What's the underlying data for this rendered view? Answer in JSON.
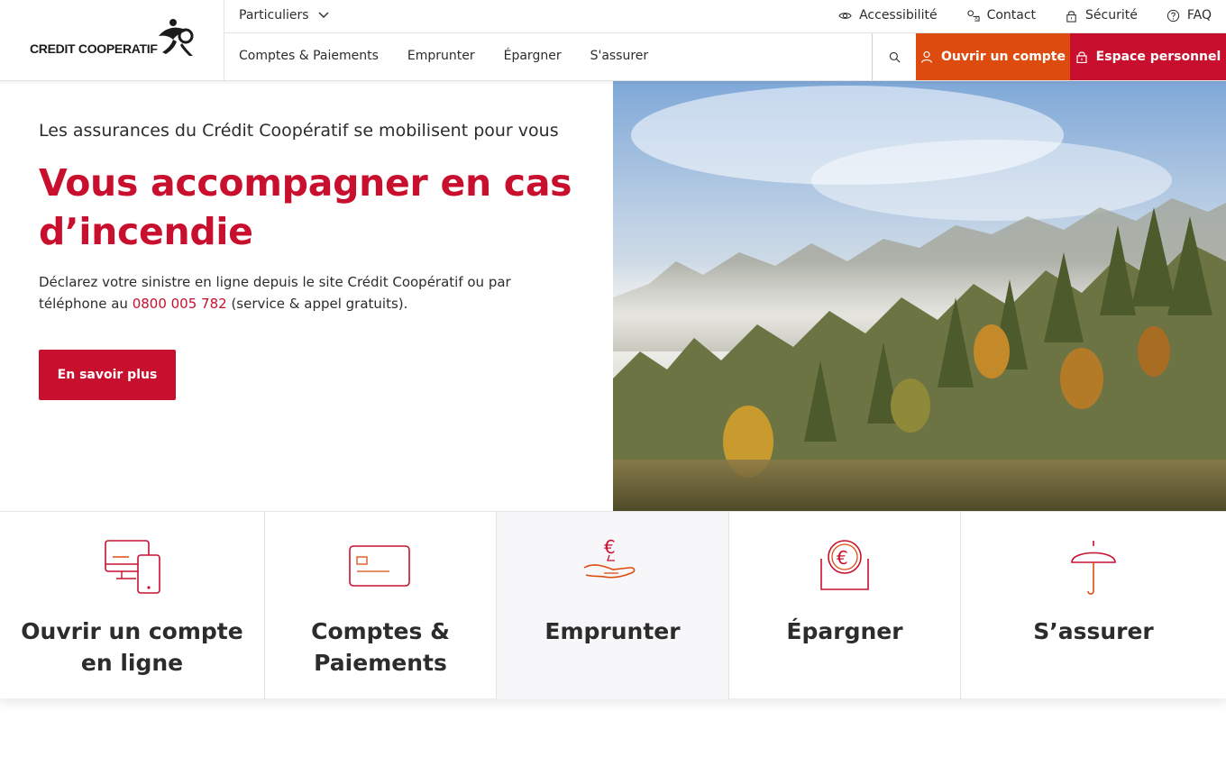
{
  "logo": {
    "text": "CREDIT COOPERATIF"
  },
  "topbar": {
    "segment": "Particuliers",
    "links": [
      {
        "label": "Accessibilité",
        "icon": "eye-icon"
      },
      {
        "label": "Contact",
        "icon": "contact-icon"
      },
      {
        "label": "Sécurité",
        "icon": "lock-icon"
      },
      {
        "label": "FAQ",
        "icon": "help-icon"
      }
    ]
  },
  "nav": {
    "items": [
      "Comptes & Paiements",
      "Emprunter",
      "Épargner",
      "S'assurer"
    ],
    "open_account": "Ouvrir un compte",
    "personal_space": "Espace personnel"
  },
  "hero": {
    "subtitle": "Les assurances du Crédit Coopératif se mobilisent pour vous",
    "title": "Vous accompagner en cas d’incendie",
    "text_before": "Déclarez votre sinistre en ligne depuis le site Crédit Coopératif ou par téléphone au ",
    "phone": "0800 005 782",
    "text_after": " (service & appel gratuits).",
    "cta": "En savoir plus"
  },
  "cards": [
    {
      "label": "Ouvrir un compte en ligne",
      "icon": "devices-icon"
    },
    {
      "label": "Comptes & Paiements",
      "icon": "card-icon"
    },
    {
      "label": "Emprunter",
      "icon": "hand-euro-icon"
    },
    {
      "label": "Épargner",
      "icon": "savings-icon"
    },
    {
      "label": "S’assurer",
      "icon": "umbrella-icon"
    }
  ],
  "colors": {
    "brand_red": "#c8102e",
    "accent_orange": "#dd4b0f",
    "text": "#2c2c2c"
  }
}
